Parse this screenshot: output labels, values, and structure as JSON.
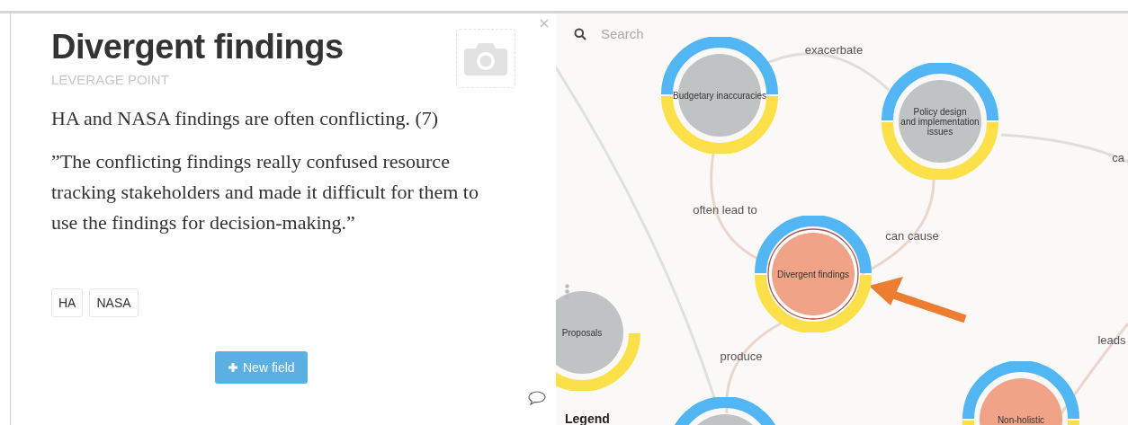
{
  "panel": {
    "title": "Divergent findings",
    "subtitle": "LEVERAGE POINT",
    "summary": "HA and NASA findings are often conflicting. (7)",
    "quote": "”The conflicting findings really confused resource tracking stakeholders and made it difficult for them to use the findings for decision-making.”",
    "tags": [
      "HA",
      "NASA"
    ],
    "new_field_button": "New field"
  },
  "map": {
    "search": {
      "placeholder": "Search"
    },
    "nodes": [
      {
        "label_lines": [
          "Budgetary inaccuracies"
        ],
        "kind": "issue",
        "top_ring": true,
        "selected": false
      },
      {
        "label_lines": [
          "Policy design",
          "and implementation",
          "issues"
        ],
        "kind": "issue",
        "top_ring": true,
        "selected": false
      },
      {
        "label_lines": [
          "Divergent findings"
        ],
        "kind": "leverage",
        "top_ring": true,
        "selected": true
      },
      {
        "label_lines": [
          "Proposals"
        ],
        "kind": "issue",
        "top_ring": false,
        "selected": false
      },
      {
        "kind": "issue",
        "top_ring": true,
        "selected": false
      },
      {
        "label_lines": [
          "Non-holistic"
        ],
        "kind": "leverage",
        "top_ring": true,
        "selected": false
      }
    ],
    "edge_labels": [
      "exacerbate",
      "ca",
      "often lead to",
      "can cause",
      "produce",
      "leads"
    ],
    "legend": "Legend"
  }
}
